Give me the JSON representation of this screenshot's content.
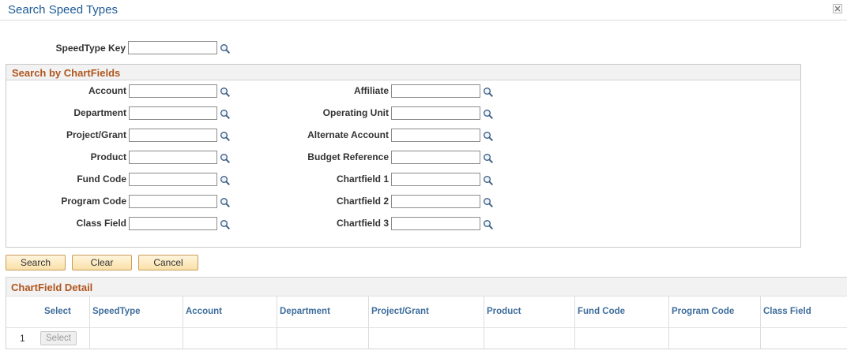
{
  "window": {
    "title": "Search Speed Types"
  },
  "speedtype_key": {
    "label": "SpeedType Key",
    "value": ""
  },
  "chartfields": {
    "title": "Search by ChartFields",
    "left": [
      {
        "label": "Account",
        "value": ""
      },
      {
        "label": "Department",
        "value": ""
      },
      {
        "label": "Project/Grant",
        "value": ""
      },
      {
        "label": "Product",
        "value": ""
      },
      {
        "label": "Fund Code",
        "value": ""
      },
      {
        "label": "Program Code",
        "value": ""
      },
      {
        "label": "Class Field",
        "value": ""
      }
    ],
    "right": [
      {
        "label": "Affiliate",
        "value": ""
      },
      {
        "label": "Operating Unit",
        "value": ""
      },
      {
        "label": "Alternate Account",
        "value": ""
      },
      {
        "label": "Budget Reference",
        "value": ""
      },
      {
        "label": "Chartfield 1",
        "value": ""
      },
      {
        "label": "Chartfield 2",
        "value": ""
      },
      {
        "label": "Chartfield 3",
        "value": ""
      }
    ]
  },
  "buttons": {
    "search": "Search",
    "clear": "Clear",
    "cancel": "Cancel"
  },
  "detail": {
    "title": "ChartField Detail",
    "columns": [
      "Select",
      "SpeedType",
      "Account",
      "Department",
      "Project/Grant",
      "Product",
      "Fund Code",
      "Program Code",
      "Class Field"
    ],
    "rows": [
      {
        "num": "1",
        "select_label": "Select"
      }
    ]
  },
  "icons": {
    "lookup": "magnifier-lookup-icon",
    "close": "close-icon"
  },
  "colors": {
    "title": "#1c5a96",
    "section_title": "#b0561e",
    "column_header": "#3e6d9c",
    "button_border": "#c99c59"
  }
}
